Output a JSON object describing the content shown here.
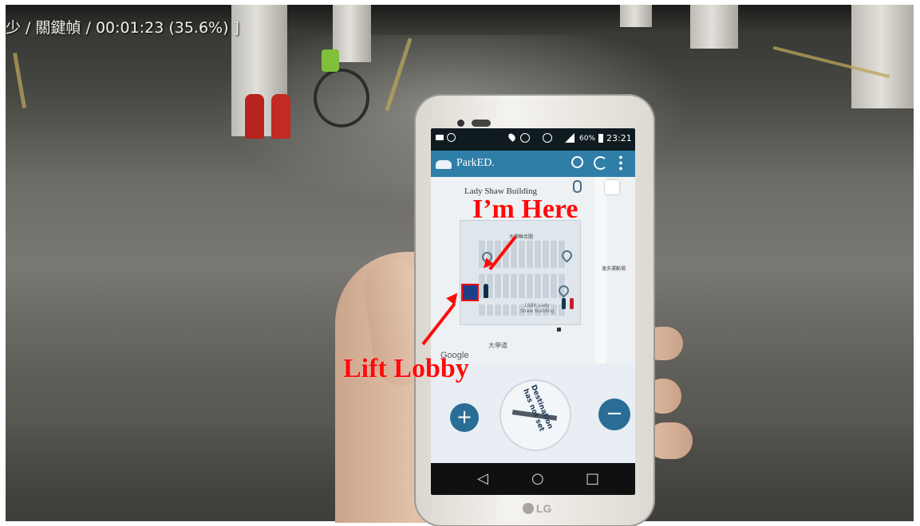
{
  "video_overlay": {
    "osd_text": "少 / 關鍵幀 / 00:01:23 (35.6%) ]"
  },
  "phone": {
    "brand": "LG",
    "status_bar": {
      "battery": "60%",
      "time": "23:21"
    },
    "app": {
      "title": "ParkED.",
      "icons": [
        "search-icon",
        "refresh-icon",
        "overflow-menu-icon"
      ]
    },
    "map": {
      "building_label": "Lady Shaw Building",
      "top_road_label": "大學聯合圖",
      "right_label": "逸夫運動場",
      "building_caption_line1": "LSBK Lady",
      "building_caption_line2": "Shaw Building",
      "road_label": "大學道",
      "google_label": "Google"
    },
    "compass": {
      "line1": "Destination",
      "line2": "has not set"
    },
    "controls": {
      "zoom_in": "+",
      "zoom_out": "−"
    },
    "navbar": {
      "back": "◁",
      "home": "○",
      "recent": "□"
    }
  },
  "annotations": {
    "im_here": "I’m Here",
    "lift_lobby": "Lift Lobby"
  },
  "colors": {
    "annotation": "#ff0a0a",
    "appbar": "#2f7ea8",
    "map_button": "#2a6d96"
  }
}
